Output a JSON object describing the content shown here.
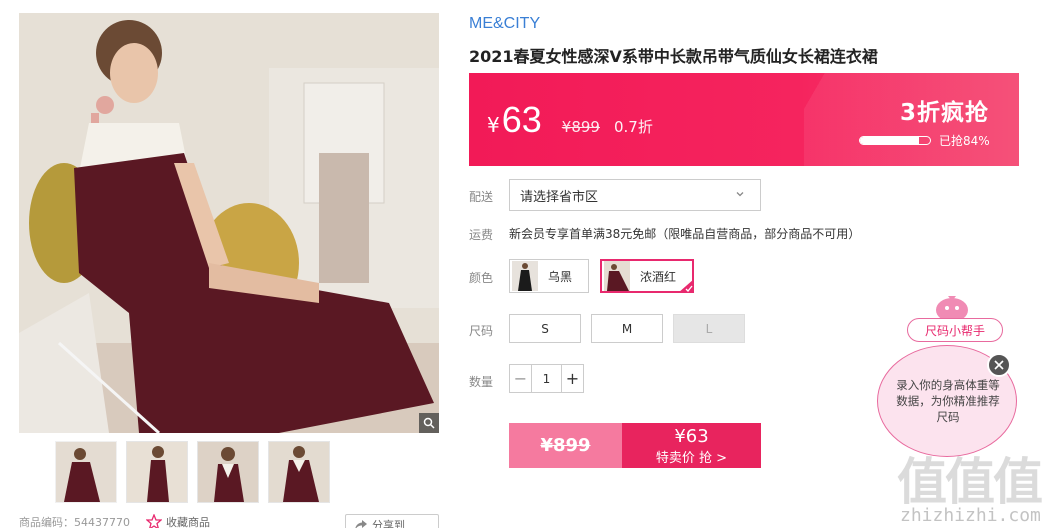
{
  "product": {
    "brand": "ME&CITY",
    "title": "2021春夏女性感深V系带中长款吊带气质仙女长裙连衣裙",
    "code_label": "商品编码：",
    "code_value": "54437770",
    "favorite_label": "收藏商品",
    "share_label": "分享到"
  },
  "price_banner": {
    "currency": "¥",
    "price": "63",
    "original_price": "¥899",
    "discount": "0.7折",
    "flash_sale": "3折疯抢",
    "sold_percent": 84,
    "sold_text": "已抢84%",
    "colors": {
      "main": "#f21a57",
      "accent": "#f4446f"
    }
  },
  "delivery": {
    "label": "配送",
    "region_placeholder": "请选择省市区"
  },
  "shipping": {
    "label": "运费",
    "text": "新会员专享首单满38元免邮（限唯品自营商品，部分商品不可用）"
  },
  "color": {
    "label": "颜色",
    "options": [
      {
        "name": "乌黑",
        "selected": false
      },
      {
        "name": "浓酒红",
        "selected": true
      }
    ]
  },
  "size": {
    "label": "尺码",
    "options": [
      {
        "name": "S",
        "disabled": false
      },
      {
        "name": "M",
        "disabled": false
      },
      {
        "name": "L",
        "disabled": true
      }
    ]
  },
  "quantity": {
    "label": "数量",
    "value": "1",
    "minus": "−",
    "plus": "+"
  },
  "buy": {
    "original_price": "¥899",
    "price": "¥63",
    "label": "特卖价 抢 >"
  },
  "size_helper": {
    "title": "尺码小帮手",
    "text": "录入你的身高体重等数据，为你精准推荐尺码"
  },
  "watermark": {
    "text": "值值值",
    "url": "zhizhizhi.com"
  },
  "icons": [
    "zoom-icon",
    "star-icon",
    "share-icon",
    "chevron-down-icon",
    "close-icon",
    "check-icon"
  ]
}
